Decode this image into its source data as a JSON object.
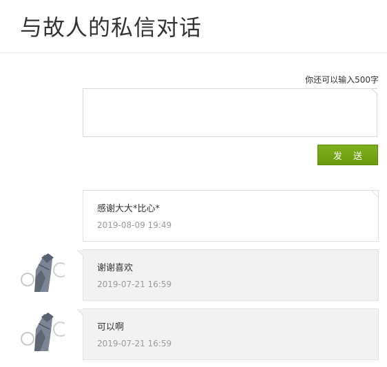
{
  "page": {
    "title": "与故人的私信对话"
  },
  "compose": {
    "counter_text": "你还可以输入500字",
    "value": "",
    "send_label": "发 送"
  },
  "messages": [
    {
      "direction": "outgoing",
      "text": "感谢大大*比心*",
      "time": "2019-08-09 19:49"
    },
    {
      "direction": "incoming",
      "text": "谢谢喜欢",
      "time": "2019-07-21 16:59"
    },
    {
      "direction": "incoming",
      "text": "可以啊",
      "time": "2019-07-21 16:59"
    }
  ],
  "colors": {
    "send_button": "#76a814",
    "incoming_bubble": "#f2f2f2",
    "outgoing_bubble": "#ffffff",
    "timestamp": "#9a9a9a"
  }
}
